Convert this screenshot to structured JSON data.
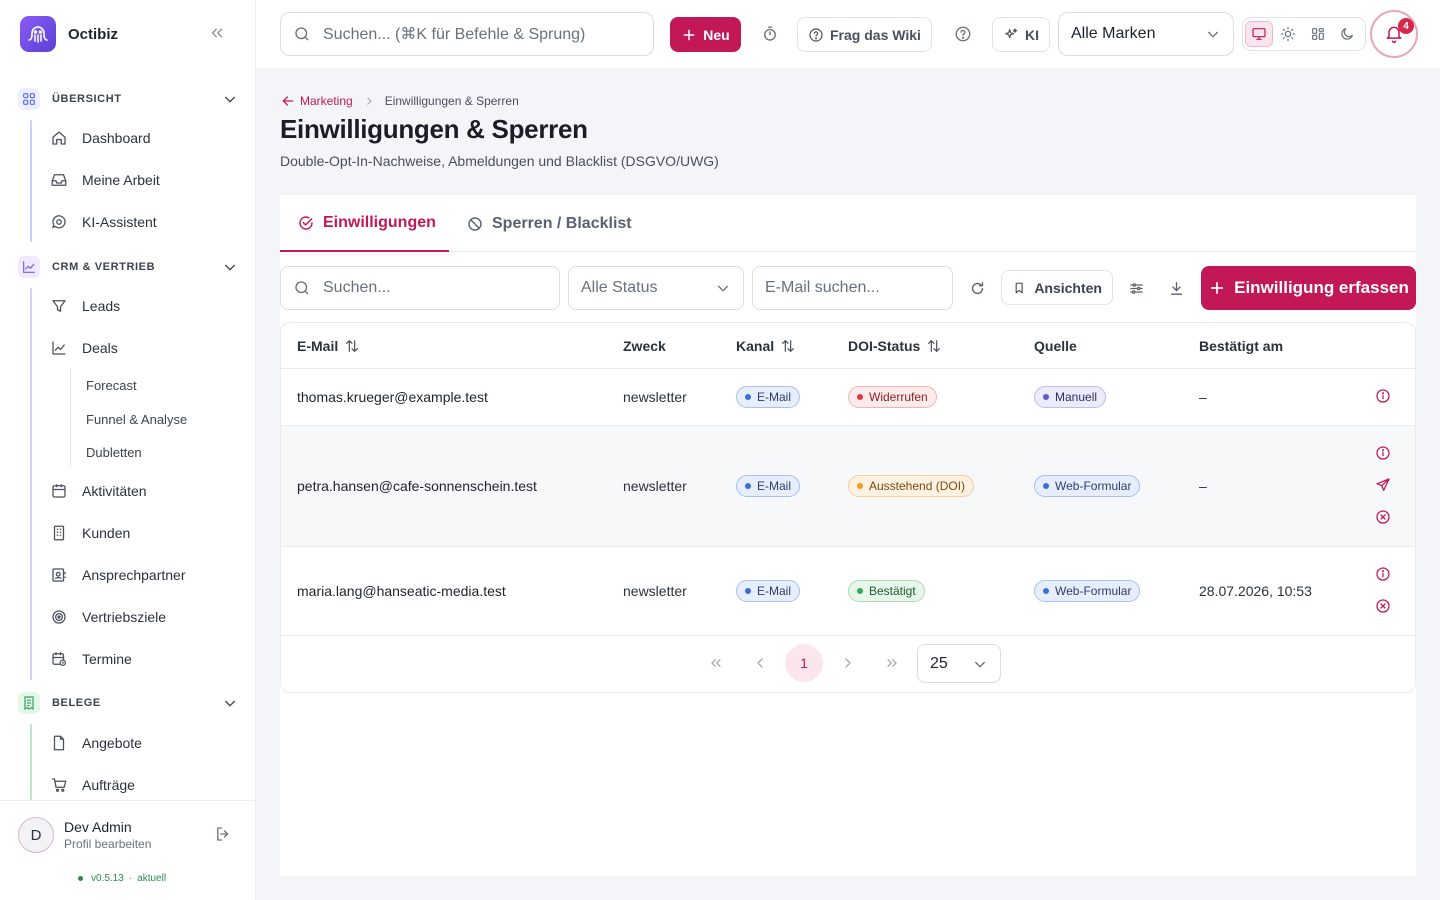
{
  "app": {
    "name": "Octibiz"
  },
  "sidebar": {
    "sections": [
      {
        "label": "ÜBERSICHT",
        "color": "#5b6ee8"
      },
      {
        "label": "CRM & VERTRIEB",
        "color": "#7c5ce8"
      },
      {
        "label": "BELEGE",
        "color": "#2fa85a"
      }
    ],
    "overview_items": [
      "Dashboard",
      "Meine Arbeit",
      "KI-Assistent"
    ],
    "crm_items": [
      "Leads",
      "Deals"
    ],
    "deals_sub": [
      "Forecast",
      "Funnel & Analyse",
      "Dubletten"
    ],
    "crm_items2": [
      "Aktivitäten",
      "Kunden",
      "Ansprechpartner",
      "Vertriebsziele",
      "Termine"
    ],
    "belege_items": [
      "Angebote",
      "Aufträge"
    ]
  },
  "user": {
    "initial": "D",
    "name": "Dev Admin",
    "profile_link": "Profil bearbeiten",
    "version": "v0.5.13",
    "version_status": "aktuell"
  },
  "topbar": {
    "search_placeholder": "Suchen... (⌘K für Befehle & Sprung)",
    "new_label": "Neu",
    "wiki_label": "Frag das Wiki",
    "ai_label": "KI",
    "brand_filter": "Alle Marken",
    "notification_count": "4"
  },
  "breadcrumb": {
    "parent": "Marketing",
    "current": "Einwilligungen & Sperren"
  },
  "page": {
    "title": "Einwilligungen & Sperren",
    "subtitle": "Double-Opt-In-Nachweise, Abmeldungen und Blacklist (DSGVO/UWG)"
  },
  "tabs": [
    {
      "label": "Einwilligungen",
      "active": true
    },
    {
      "label": "Sperren / Blacklist",
      "active": false
    }
  ],
  "filters": {
    "search_placeholder": "Suchen...",
    "status_value": "Alle Status",
    "email_placeholder": "E-Mail suchen...",
    "views_label": "Ansichten",
    "add_label": "Einwilligung erfassen"
  },
  "table": {
    "columns": [
      "E-Mail",
      "Zweck",
      "Kanal",
      "DOI-Status",
      "Quelle",
      "Bestätigt am"
    ],
    "rows": [
      {
        "email": "thomas.krueger@example.test",
        "purpose": "newsletter",
        "channel": "E-Mail",
        "doi": "Widerrufen",
        "source": "Manuell",
        "confirmed": "–"
      },
      {
        "email": "petra.hansen@cafe-sonnenschein.test",
        "purpose": "newsletter",
        "channel": "E-Mail",
        "doi": "Ausstehend (DOI)",
        "source": "Web-Formular",
        "confirmed": "–"
      },
      {
        "email": "maria.lang@hanseatic-media.test",
        "purpose": "newsletter",
        "channel": "E-Mail",
        "doi": "Bestätigt",
        "source": "Web-Formular",
        "confirmed": "28.07.2026, 10:53"
      }
    ]
  },
  "pagination": {
    "current_page": "1",
    "page_size": "25"
  },
  "colors": {
    "accent": "#c21858"
  }
}
